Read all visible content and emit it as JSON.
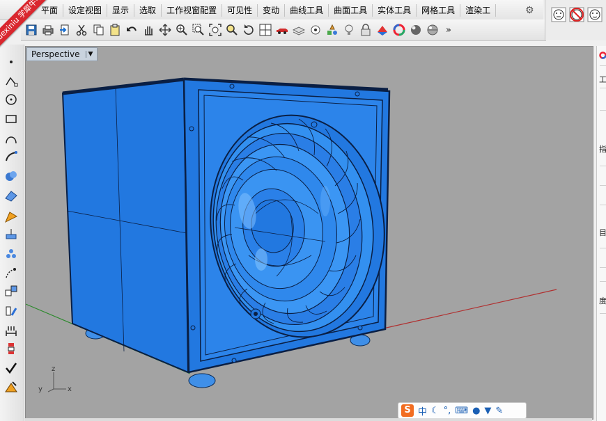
{
  "watermark": "xuexiniu 学犀牛中文网",
  "menu": {
    "tabs": [
      "平面",
      "设定视图",
      "显示",
      "选取",
      "工作视窗配置",
      "可见性",
      "变动",
      "曲线工具",
      "曲面工具",
      "实体工具",
      "网格工具",
      "渲染工"
    ],
    "gear_icon": "gear-icon"
  },
  "toolbar": {
    "more": "»",
    "icons": [
      "save-icon",
      "print-icon",
      "import-icon",
      "cut-icon",
      "copy-icon",
      "paste-icon",
      "undo-icon",
      "pan-hand-icon",
      "move-view-icon",
      "zoom-icon",
      "zoom-window-icon",
      "zoom-extents-icon",
      "zoom-selected-icon",
      "rotate-view-icon",
      "four-viewports-icon",
      "car-icon",
      "layer-icon",
      "point-icon",
      "analyze-icon",
      "light-icon",
      "lock-icon",
      "material-icon",
      "color-wheel-icon",
      "render-sphere-icon",
      "sphere-icon"
    ]
  },
  "viewport": {
    "name": "Perspective",
    "caret": "▼",
    "axis_labels": {
      "z": "z",
      "y": "y",
      "x": "x"
    }
  },
  "ime_bar": {
    "logo": "S",
    "mode": "中",
    "icons": [
      "moon-icon",
      "punctuation-icon",
      "keyboard-icon",
      "person-icon",
      "shirt-icon",
      "wrench-icon"
    ]
  },
  "right_panel": {
    "labels": [
      "工",
      "指",
      "目",
      "度"
    ]
  },
  "colors": {
    "viewport_bg": "#a3a3a3",
    "model_blue": "#2278e0",
    "x_axis": "#b03030",
    "y_axis": "#2f8a2f"
  }
}
